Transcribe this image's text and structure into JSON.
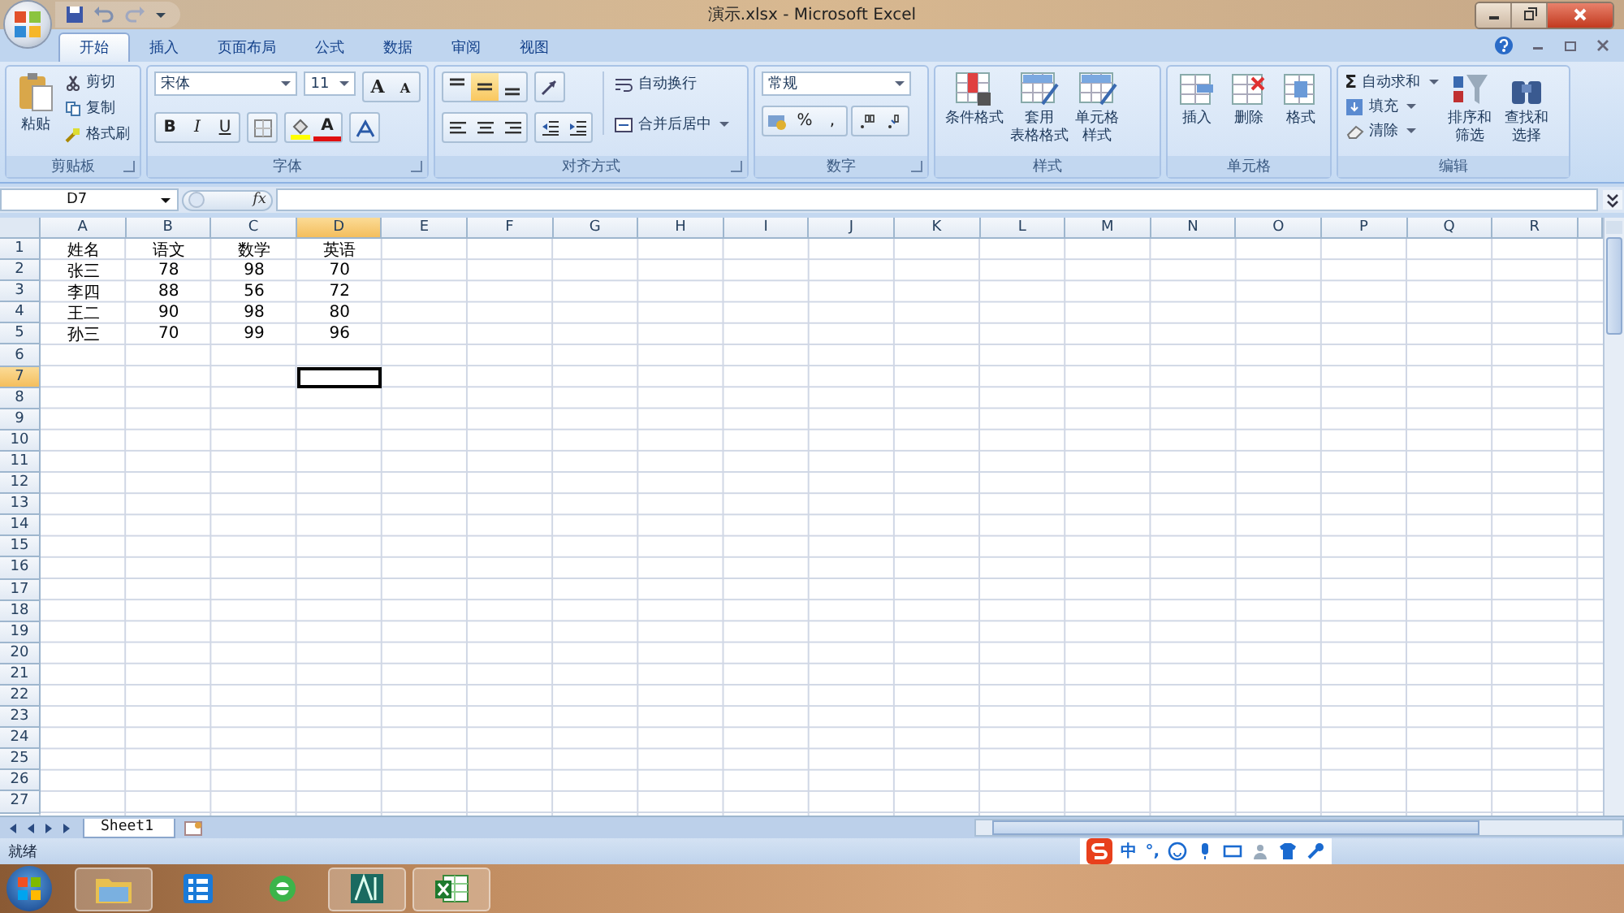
{
  "title": "演示.xlsx - Microsoft Excel",
  "tabs": [
    {
      "label": "开始",
      "selected": true
    },
    {
      "label": "插入",
      "selected": false
    },
    {
      "label": "页面布局",
      "selected": false
    },
    {
      "label": "公式",
      "selected": false
    },
    {
      "label": "数据",
      "selected": false
    },
    {
      "label": "审阅",
      "selected": false
    },
    {
      "label": "视图",
      "selected": false
    }
  ],
  "ribbon": {
    "clipboard": {
      "label": "剪贴板",
      "paste": "粘贴",
      "items": [
        "剪切",
        "复制",
        "格式刷"
      ]
    },
    "font": {
      "label": "字体",
      "font_name": "宋体",
      "font_size": "11",
      "grow": "A",
      "shrink": "A",
      "styles": [
        "B",
        "I",
        "U"
      ],
      "color_letter": "A"
    },
    "alignment": {
      "label": "对齐方式",
      "vertical": [
        {
          "selected": false
        },
        {
          "selected": true
        },
        {
          "selected": false
        }
      ],
      "wrap": "自动换行",
      "merge": "合并后居中"
    },
    "number": {
      "label": "数字",
      "format": "常规",
      "percent": "%",
      "comma": ","
    },
    "styles": {
      "label": "样式",
      "buttons": [
        {
          "lines": [
            "条件格式"
          ]
        },
        {
          "lines": [
            "套用",
            "表格格式"
          ]
        },
        {
          "lines": [
            "单元格",
            "样式"
          ]
        }
      ]
    },
    "cells": {
      "label": "单元格",
      "buttons": [
        "插入",
        "删除",
        "格式"
      ]
    },
    "editing": {
      "label": "编辑",
      "sum_symbol": "Σ",
      "small": [
        "自动求和",
        "填充",
        "清除"
      ],
      "big": [
        {
          "lines": [
            "排序和",
            "筛选"
          ]
        },
        {
          "lines": [
            "查找和",
            "选择"
          ]
        }
      ]
    }
  },
  "formula_bar": {
    "name_box": "D7",
    "fx": "fx"
  },
  "sheet": {
    "columns": [
      {
        "label": "A",
        "selected": false
      },
      {
        "label": "B",
        "selected": false
      },
      {
        "label": "C",
        "selected": false
      },
      {
        "label": "D",
        "selected": true
      },
      {
        "label": "E",
        "selected": false
      },
      {
        "label": "F",
        "selected": false
      },
      {
        "label": "G",
        "selected": false
      },
      {
        "label": "H",
        "selected": false
      },
      {
        "label": "I",
        "selected": false
      },
      {
        "label": "J",
        "selected": false
      },
      {
        "label": "K",
        "selected": false
      },
      {
        "label": "L",
        "selected": false
      },
      {
        "label": "M",
        "selected": false
      },
      {
        "label": "N",
        "selected": false
      },
      {
        "label": "O",
        "selected": false
      },
      {
        "label": "P",
        "selected": false
      },
      {
        "label": "Q",
        "selected": false
      },
      {
        "label": "R",
        "selected": false
      }
    ],
    "rows": [
      {
        "label": "1",
        "selected": false,
        "cells": [
          "姓名",
          "语文",
          "数学",
          "英语"
        ]
      },
      {
        "label": "2",
        "selected": false,
        "cells": [
          "张三",
          "78",
          "98",
          "70"
        ]
      },
      {
        "label": "3",
        "selected": false,
        "cells": [
          "李四",
          "88",
          "56",
          "72"
        ]
      },
      {
        "label": "4",
        "selected": false,
        "cells": [
          "王二",
          "90",
          "98",
          "80"
        ]
      },
      {
        "label": "5",
        "selected": false,
        "cells": [
          "孙三",
          "70",
          "99",
          "96"
        ]
      },
      {
        "label": "6",
        "selected": false,
        "cells": []
      },
      {
        "label": "7",
        "selected": true,
        "cells": []
      },
      {
        "label": "8",
        "selected": false,
        "cells": []
      },
      {
        "label": "9",
        "selected": false,
        "cells": []
      },
      {
        "label": "10",
        "selected": false,
        "cells": []
      },
      {
        "label": "11",
        "selected": false,
        "cells": []
      },
      {
        "label": "12",
        "selected": false,
        "cells": []
      },
      {
        "label": "13",
        "selected": false,
        "cells": []
      },
      {
        "label": "14",
        "selected": false,
        "cells": []
      },
      {
        "label": "15",
        "selected": false,
        "cells": []
      },
      {
        "label": "16",
        "selected": false,
        "cells": []
      },
      {
        "label": "17",
        "selected": false,
        "cells": []
      },
      {
        "label": "18",
        "selected": false,
        "cells": []
      },
      {
        "label": "19",
        "selected": false,
        "cells": []
      },
      {
        "label": "20",
        "selected": false,
        "cells": []
      },
      {
        "label": "21",
        "selected": false,
        "cells": []
      },
      {
        "label": "22",
        "selected": false,
        "cells": []
      },
      {
        "label": "23",
        "selected": false,
        "cells": []
      },
      {
        "label": "24",
        "selected": false,
        "cells": []
      },
      {
        "label": "25",
        "selected": false,
        "cells": []
      },
      {
        "label": "26",
        "selected": false,
        "cells": []
      },
      {
        "label": "27",
        "selected": false,
        "cells": []
      }
    ]
  },
  "sheet_tabs": [
    {
      "label": "Sheet1",
      "selected": true
    }
  ],
  "status": "就绪",
  "ime": {
    "mode": "中",
    "punct": "°,"
  },
  "taskbar": [
    {
      "kind": "folder",
      "running": true
    },
    {
      "kind": "list",
      "running": false
    },
    {
      "kind": "browser",
      "running": false
    },
    {
      "kind": "cad",
      "running": true
    },
    {
      "kind": "excel",
      "running": true
    }
  ]
}
